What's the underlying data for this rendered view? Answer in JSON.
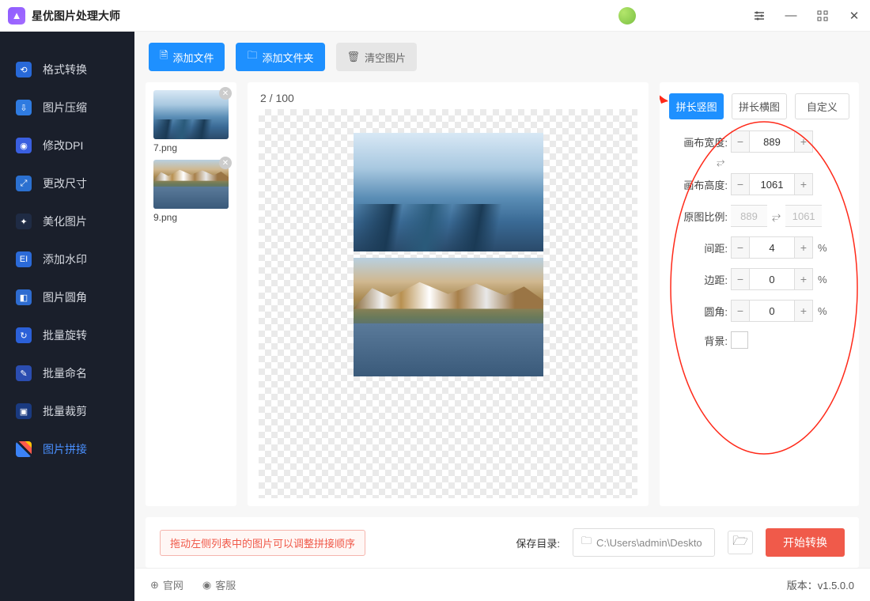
{
  "app": {
    "title": "星优图片处理大师"
  },
  "titlebar_icons": {
    "settings": "settings-icon",
    "min": "minimize-icon",
    "max": "maximize-icon",
    "close": "close-icon"
  },
  "sidebar": {
    "items": [
      {
        "label": "格式转换"
      },
      {
        "label": "图片压缩"
      },
      {
        "label": "修改DPI"
      },
      {
        "label": "更改尺寸"
      },
      {
        "label": "美化图片"
      },
      {
        "label": "添加水印"
      },
      {
        "label": "图片圆角"
      },
      {
        "label": "批量旋转"
      },
      {
        "label": "批量命名"
      },
      {
        "label": "批量裁剪"
      },
      {
        "label": "图片拼接"
      }
    ],
    "active_index": 10
  },
  "toolbar": {
    "add_file": "添加文件",
    "add_folder": "添加文件夹",
    "clear": "清空图片"
  },
  "thumbs": [
    {
      "name": "7.png"
    },
    {
      "name": "9.png"
    }
  ],
  "preview": {
    "counter": "2 / 100"
  },
  "settings": {
    "tabs": [
      {
        "label": "拼长竖图",
        "active": true
      },
      {
        "label": "拼长横图",
        "active": false
      },
      {
        "label": "自定义",
        "active": false
      }
    ],
    "canvas_width": {
      "label": "画布宽度:",
      "value": "889"
    },
    "canvas_height": {
      "label": "画布高度:",
      "value": "1061"
    },
    "orig_ratio": {
      "label": "原图比例:",
      "w": "889",
      "h": "1061"
    },
    "gap": {
      "label": "间距:",
      "value": "4",
      "unit": "%"
    },
    "margin": {
      "label": "边距:",
      "value": "0",
      "unit": "%"
    },
    "radius": {
      "label": "圆角:",
      "value": "0",
      "unit": "%"
    },
    "bg": {
      "label": "背景:",
      "color": "#ffffff"
    }
  },
  "bottom": {
    "hint": "拖动左侧列表中的图片可以调整拼接顺序",
    "save_label": "保存目录:",
    "path": "C:\\Users\\admin\\Deskto",
    "start": "开始转换"
  },
  "footer": {
    "website": "官网",
    "support": "客服",
    "version_label": "版本：",
    "version": "v1.5.0.0"
  }
}
